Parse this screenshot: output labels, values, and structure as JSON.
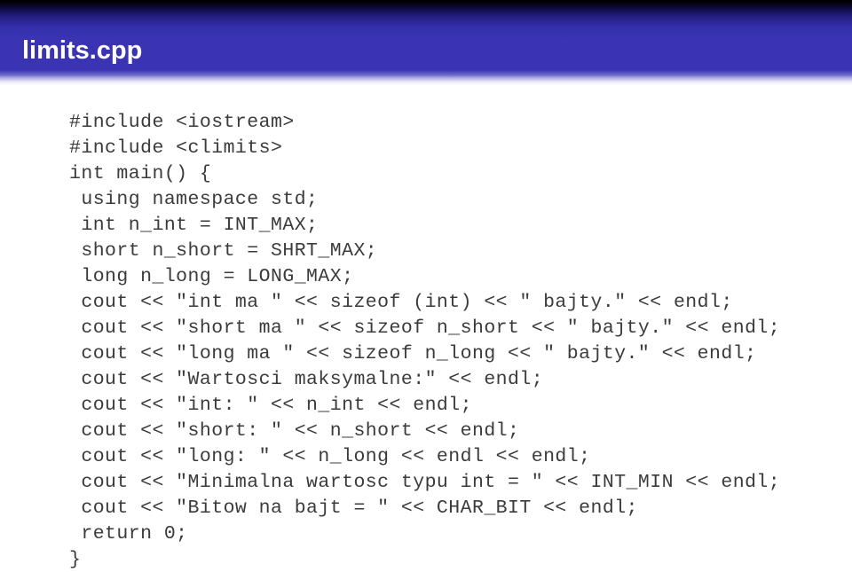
{
  "header": {
    "title": "limits.cpp",
    "accent_color": "#3a33b4",
    "top_color": "#000000",
    "title_color": "#ffffff"
  },
  "code": {
    "language": "cpp",
    "text_color": "#3b3b3b",
    "background_color": "#ffffff",
    "lines": [
      "#include <iostream>",
      "#include <climits>",
      "int main() {",
      " using namespace std;",
      " int n_int = INT_MAX;",
      " short n_short = SHRT_MAX;",
      " long n_long = LONG_MAX;",
      " cout << \"int ma \" << sizeof (int) << \" bajty.\" << endl;",
      " cout << \"short ma \" << sizeof n_short << \" bajty.\" << endl;",
      " cout << \"long ma \" << sizeof n_long << \" bajty.\" << endl;",
      " cout << \"Wartosci maksymalne:\" << endl;",
      " cout << \"int: \" << n_int << endl;",
      " cout << \"short: \" << n_short << endl;",
      " cout << \"long: \" << n_long << endl << endl;",
      " cout << \"Minimalna wartosc typu int = \" << INT_MIN << endl;",
      " cout << \"Bitow na bajt = \" << CHAR_BIT << endl;",
      " return 0;",
      "}"
    ]
  }
}
